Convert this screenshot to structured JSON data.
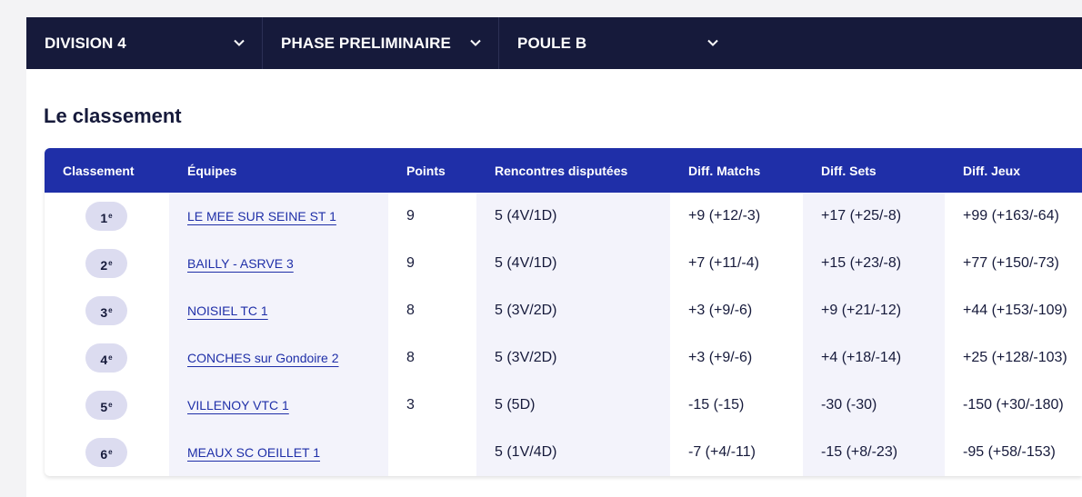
{
  "filters": [
    {
      "label": "DIVISION 4"
    },
    {
      "label": "PHASE PRELIMINAIRE"
    },
    {
      "label": "POULE B"
    }
  ],
  "section_title": "Le classement",
  "table": {
    "headers": [
      "Classement",
      "Équipes",
      "Points",
      "Rencontres disputées",
      "Diff. Matchs",
      "Diff. Sets",
      "Diff. Jeux"
    ],
    "rank_suffix": "e",
    "rows": [
      {
        "rank": "1",
        "team": "LE MEE SUR SEINE ST 1",
        "points": "9",
        "rencontres": "5 (4V/1D)",
        "diff_matchs": "+9 (+12/-3)",
        "diff_sets": "+17 (+25/-8)",
        "diff_jeux": "+99 (+163/-64)"
      },
      {
        "rank": "2",
        "team": "BAILLY - ASRVE 3",
        "points": "9",
        "rencontres": "5 (4V/1D)",
        "diff_matchs": "+7 (+11/-4)",
        "diff_sets": "+15 (+23/-8)",
        "diff_jeux": "+77 (+150/-73)"
      },
      {
        "rank": "3",
        "team": "NOISIEL TC 1",
        "points": "8",
        "rencontres": "5 (3V/2D)",
        "diff_matchs": "+3 (+9/-6)",
        "diff_sets": "+9 (+21/-12)",
        "diff_jeux": "+44 (+153/-109)"
      },
      {
        "rank": "4",
        "team": "CONCHES sur Gondoire 2",
        "points": "8",
        "rencontres": "5 (3V/2D)",
        "diff_matchs": "+3 (+9/-6)",
        "diff_sets": "+4 (+18/-14)",
        "diff_jeux": "+25 (+128/-103)"
      },
      {
        "rank": "5",
        "team": "VILLENOY VTC 1",
        "points": "3",
        "rencontres": "5 (5D)",
        "diff_matchs": "-15 (-15)",
        "diff_sets": "-30 (-30)",
        "diff_jeux": "-150 (+30/-180)"
      },
      {
        "rank": "6",
        "team": "MEAUX SC OEILLET 1",
        "points": "",
        "rencontres": "5 (1V/4D)",
        "diff_matchs": "-7 (+4/-11)",
        "diff_sets": "-15 (+8/-23)",
        "diff_jeux": "-95 (+58/-153)"
      }
    ]
  },
  "colors": {
    "topbar": "#161a3b",
    "header": "#1f2fa8",
    "link": "#1f2fa8",
    "stripe": "#f3f3fb",
    "rank_pill": "#dcdcf0"
  },
  "icons": {
    "dropdown": "chevron-down-icon"
  }
}
